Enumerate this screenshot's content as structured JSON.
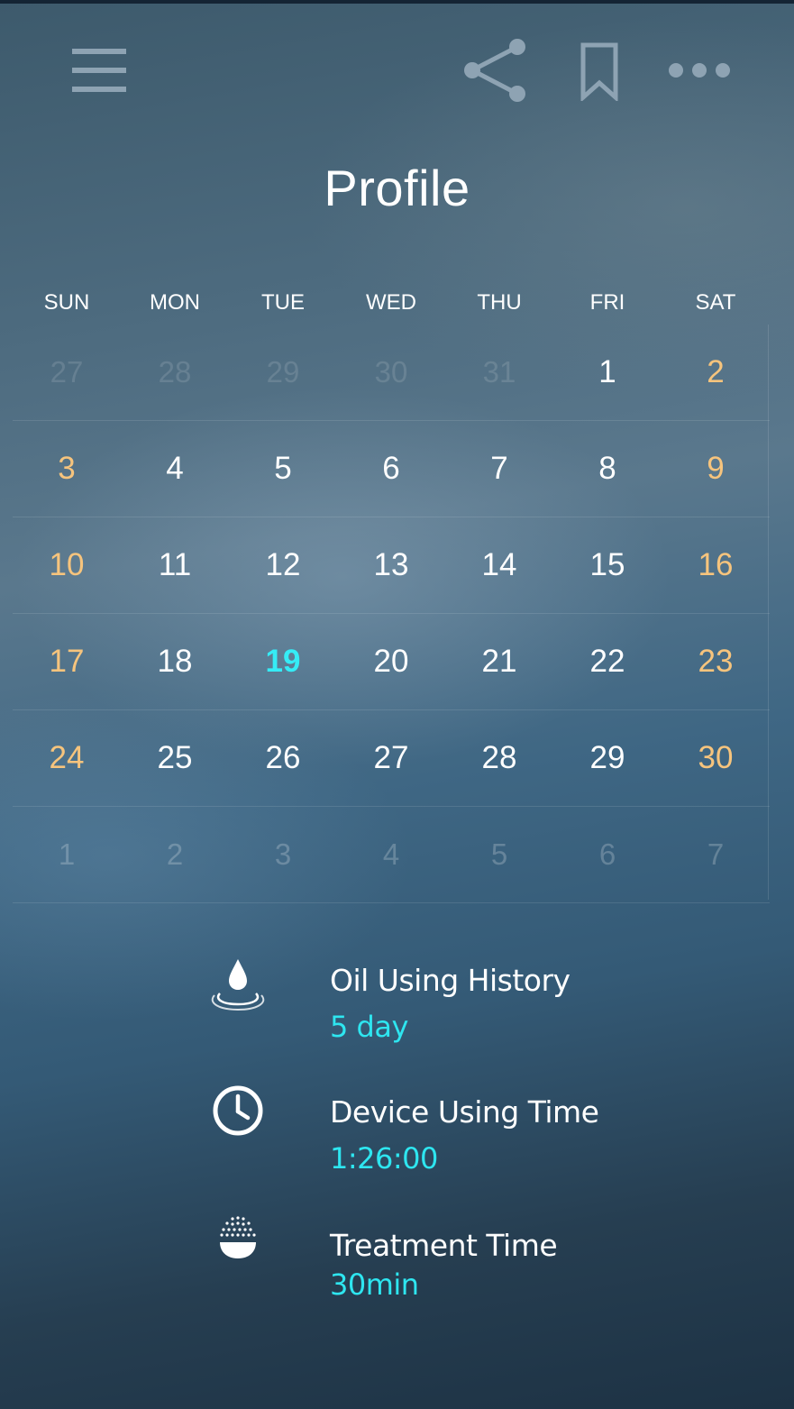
{
  "header": {
    "title": "Profile",
    "icons": [
      "menu-icon",
      "share-icon",
      "bookmark-icon",
      "more-icon"
    ]
  },
  "colors": {
    "weekend": "#f6c47d",
    "today": "#35ecf6",
    "accent_value": "#2ee6f0",
    "text": "#ffffff"
  },
  "calendar": {
    "weekdays": [
      "SUN",
      "MON",
      "TUE",
      "WED",
      "THU",
      "FRI",
      "SAT"
    ],
    "today": "19",
    "weeks": [
      [
        "27",
        "28",
        "29",
        "30",
        "31",
        "1",
        "2"
      ],
      [
        "3",
        "4",
        "5",
        "6",
        "7",
        "8",
        "9"
      ],
      [
        "10",
        "11",
        "12",
        "13",
        "14",
        "15",
        "16"
      ],
      [
        "17",
        "18",
        "19",
        "20",
        "21",
        "22",
        "23"
      ],
      [
        "24",
        "25",
        "26",
        "27",
        "28",
        "29",
        "30"
      ],
      [
        "1",
        "2",
        "3",
        "4",
        "5",
        "6",
        "7"
      ]
    ]
  },
  "stats": [
    {
      "icon": "oil-drop-icon",
      "label": "Oil Using History",
      "value": "5 day"
    },
    {
      "icon": "clock-icon",
      "label": "Device Using Time",
      "value": "1:26:00"
    },
    {
      "icon": "treatment-spray-icon",
      "label": "Treatment Time",
      "value": "30min"
    }
  ]
}
